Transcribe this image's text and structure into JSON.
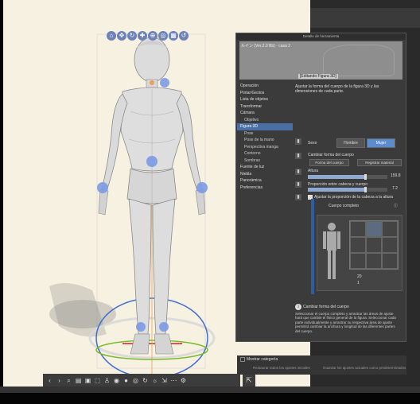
{
  "panel": {
    "title": "Detalle de herramienta",
    "preview_title": "ルイン (Ver.2.0 Bb) · casa 2",
    "preview_subtitle": "[Editando Figura 3D]",
    "categories": [
      {
        "label": "Operación",
        "sub": false,
        "selected": false
      },
      {
        "label": "Pintar/Gestos",
        "sub": false,
        "selected": false
      },
      {
        "label": "Lista de objetos",
        "sub": false,
        "selected": false
      },
      {
        "label": "Transformar",
        "sub": false,
        "selected": false
      },
      {
        "label": "Cámara",
        "sub": false,
        "selected": false
      },
      {
        "label": "Objetivo",
        "sub": true,
        "selected": false
      },
      {
        "label": "Figura 3D",
        "sub": false,
        "selected": true
      },
      {
        "label": "Pose",
        "sub": true,
        "selected": false
      },
      {
        "label": "Pose de la mano",
        "sub": true,
        "selected": false
      },
      {
        "label": "Perspectiva manga",
        "sub": true,
        "selected": false
      },
      {
        "label": "Contorno",
        "sub": true,
        "selected": false
      },
      {
        "label": "Sombras",
        "sub": true,
        "selected": false
      },
      {
        "label": "Fuente de luz",
        "sub": false,
        "selected": false
      },
      {
        "label": "Niebla",
        "sub": false,
        "selected": false
      },
      {
        "label": "Panorámica",
        "sub": false,
        "selected": false
      },
      {
        "label": "Preferencias",
        "sub": false,
        "selected": false
      }
    ],
    "intro_line1": "Ajustar la forma del cuerpo de la figura 3D y las",
    "intro_line2": "dimensiones de cada parte.",
    "gender": {
      "body": "Sexo",
      "male": "Hombre",
      "female": "Mujer"
    },
    "shape_header": "Cambiar forma del cuerpo",
    "shape_btn": "Forma del cuerpo",
    "register_btn": "Registrar material",
    "height_label": "Altura",
    "height_value": "159.8",
    "height_ratio": 0.72,
    "head_ratio_label": "Proporción entre cabeza y cuerpo",
    "head_ratio_value": "7.2",
    "head_ratio": 0.72,
    "adjust_label": "Ajustar la proporción de la cabeza a la altura",
    "body_full_label": "Cuerpo completo",
    "val1": "20",
    "val2": "1",
    "info_header": "Cambiar forma del cuerpo",
    "info_desc": "Seleccionar el cuerpo completo y arrastrar las áreas de ajuste hará que cambie el físico general de la figura. Seleccionar cada parte individualmente y arrastrar su respectiva área de ajuste permitirá cambiar la anchura y longitud de las diferentes partes del cuerpo.",
    "show_category": "Mostrar categoría",
    "reset_all": "Restaurar todos los ajustes iniciales",
    "save_all": "Guardar los ajustes actuales como predeterminados"
  },
  "toolbar3d_icons": [
    "camera-icon",
    "move-icon",
    "rotate-icon",
    "pan-icon",
    "zoom-icon",
    "orbit-icon",
    "ground-icon",
    "reset-icon"
  ],
  "bottombar_icons": [
    "prev-icon",
    "next-icon",
    "search-icon",
    "layers-icon",
    "lock-icon",
    "frame-icon",
    "pose-icon",
    "camera-icon",
    "record-icon",
    "center-icon",
    "rotate-icon",
    "light-icon",
    "export-icon",
    "more-icon",
    "settings-icon"
  ],
  "colors": {
    "accent": "#5b8bd0",
    "selected": "#4a6fa5",
    "canvas": "#f7f1e1"
  }
}
